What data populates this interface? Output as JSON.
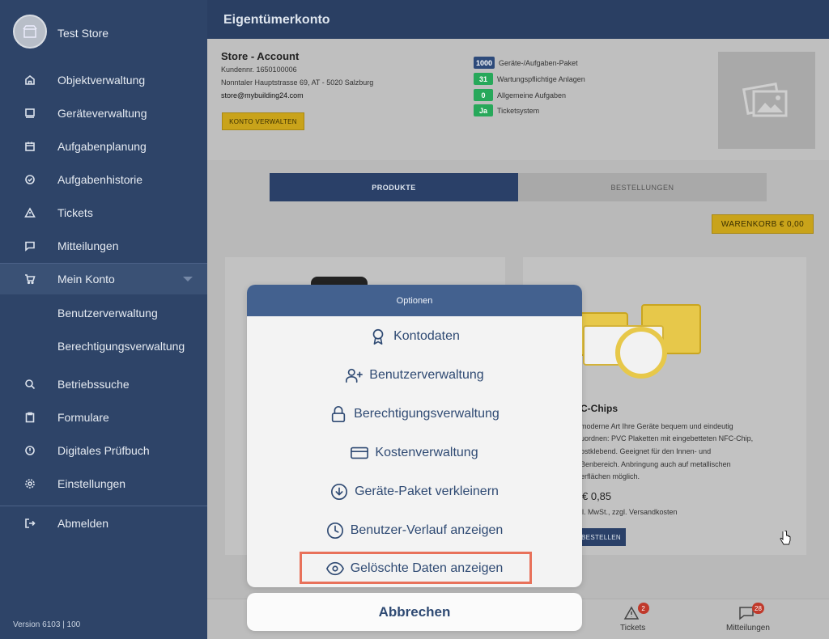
{
  "sidebar": {
    "store_name": "Test Store",
    "items": [
      {
        "label": "Objektverwaltung",
        "icon": "home-icon"
      },
      {
        "label": "Geräteverwaltung",
        "icon": "monitor-icon"
      },
      {
        "label": "Aufgabenplanung",
        "icon": "calendar-icon"
      },
      {
        "label": "Aufgabenhistorie",
        "icon": "check-circle-icon"
      },
      {
        "label": "Tickets",
        "icon": "warning-icon"
      },
      {
        "label": "Mitteilungen",
        "icon": "message-icon"
      },
      {
        "label": "Mein Konto",
        "icon": "cart-icon"
      },
      {
        "label": "Benutzerverwaltung"
      },
      {
        "label": "Berechtigungsverwaltung"
      },
      {
        "label": "Betriebssuche",
        "icon": "search-icon"
      },
      {
        "label": "Formulare",
        "icon": "clipboard-icon"
      },
      {
        "label": "Digitales Prüfbuch",
        "icon": "info-icon"
      },
      {
        "label": "Einstellungen",
        "icon": "gear-icon"
      },
      {
        "label": "Abmelden",
        "icon": "logout-icon"
      }
    ],
    "version": "Version 6103 | 100"
  },
  "header": {
    "title": "Eigentümerkonto"
  },
  "account": {
    "title": "Store - Account",
    "kundennr": "Kundennr. 1650100006",
    "address": "Nonntaler Hauptstrasse 69, AT - 5020 Salzburg",
    "email": "store@mybuilding24.com",
    "manage_button": "KONTO VERWALTEN",
    "stats": [
      {
        "value": "1000",
        "label": "Geräte-/Aufgaben-Paket",
        "color": "#2d4a7a"
      },
      {
        "value": "31",
        "label": "Wartungspflichtige Anlagen",
        "color": "#27a85a"
      },
      {
        "value": "0",
        "label": "Allgemeine Aufgaben",
        "color": "#27a85a"
      },
      {
        "value": "Ja",
        "label": "Ticketsystem",
        "color": "#27a85a"
      }
    ]
  },
  "tabs": [
    {
      "label": "PRODUKTE",
      "active": true
    },
    {
      "label": "BESTELLUNGEN",
      "active": false
    }
  ],
  "cart_button": "WARENKORB € 0,00",
  "product": {
    "title": "C-Chips",
    "desc_lines": [
      "moderne Art Ihre Geräte bequem und eindeutig",
      "uordnen: PVC Plaketten mit eingebetteten NFC-Chip,",
      "ostklebend. Geeignet für den Innen- und",
      "Benbereich. Anbringung auch auf metallischen",
      "erflächen möglich."
    ],
    "price": "€ 0,85",
    "price_note": "l. MwSt., zzgl. Versandkosten",
    "order_button": "BESTELLEN"
  },
  "bottom_nav": [
    {
      "label": "Tickets",
      "count": "2",
      "icon": "warning-icon"
    },
    {
      "label": "Mitteilungen",
      "count": "28",
      "icon": "message-icon"
    }
  ],
  "modal": {
    "title": "Optionen",
    "options": [
      {
        "label": "Kontodaten",
        "icon": "award-icon"
      },
      {
        "label": "Benutzerverwaltung",
        "icon": "user-plus-icon"
      },
      {
        "label": "Berechtigungsverwaltung",
        "icon": "lock-icon"
      },
      {
        "label": "Kostenverwaltung",
        "icon": "credit-card-icon"
      },
      {
        "label": "Geräte-Paket verkleinern",
        "icon": "arrow-down-circle-icon"
      },
      {
        "label": "Benutzer-Verlauf anzeigen",
        "icon": "clock-icon"
      },
      {
        "label": "Gelöschte Daten anzeigen",
        "icon": "eye-icon"
      }
    ],
    "cancel": "Abbrechen",
    "highlight_color": "#e8715a"
  }
}
